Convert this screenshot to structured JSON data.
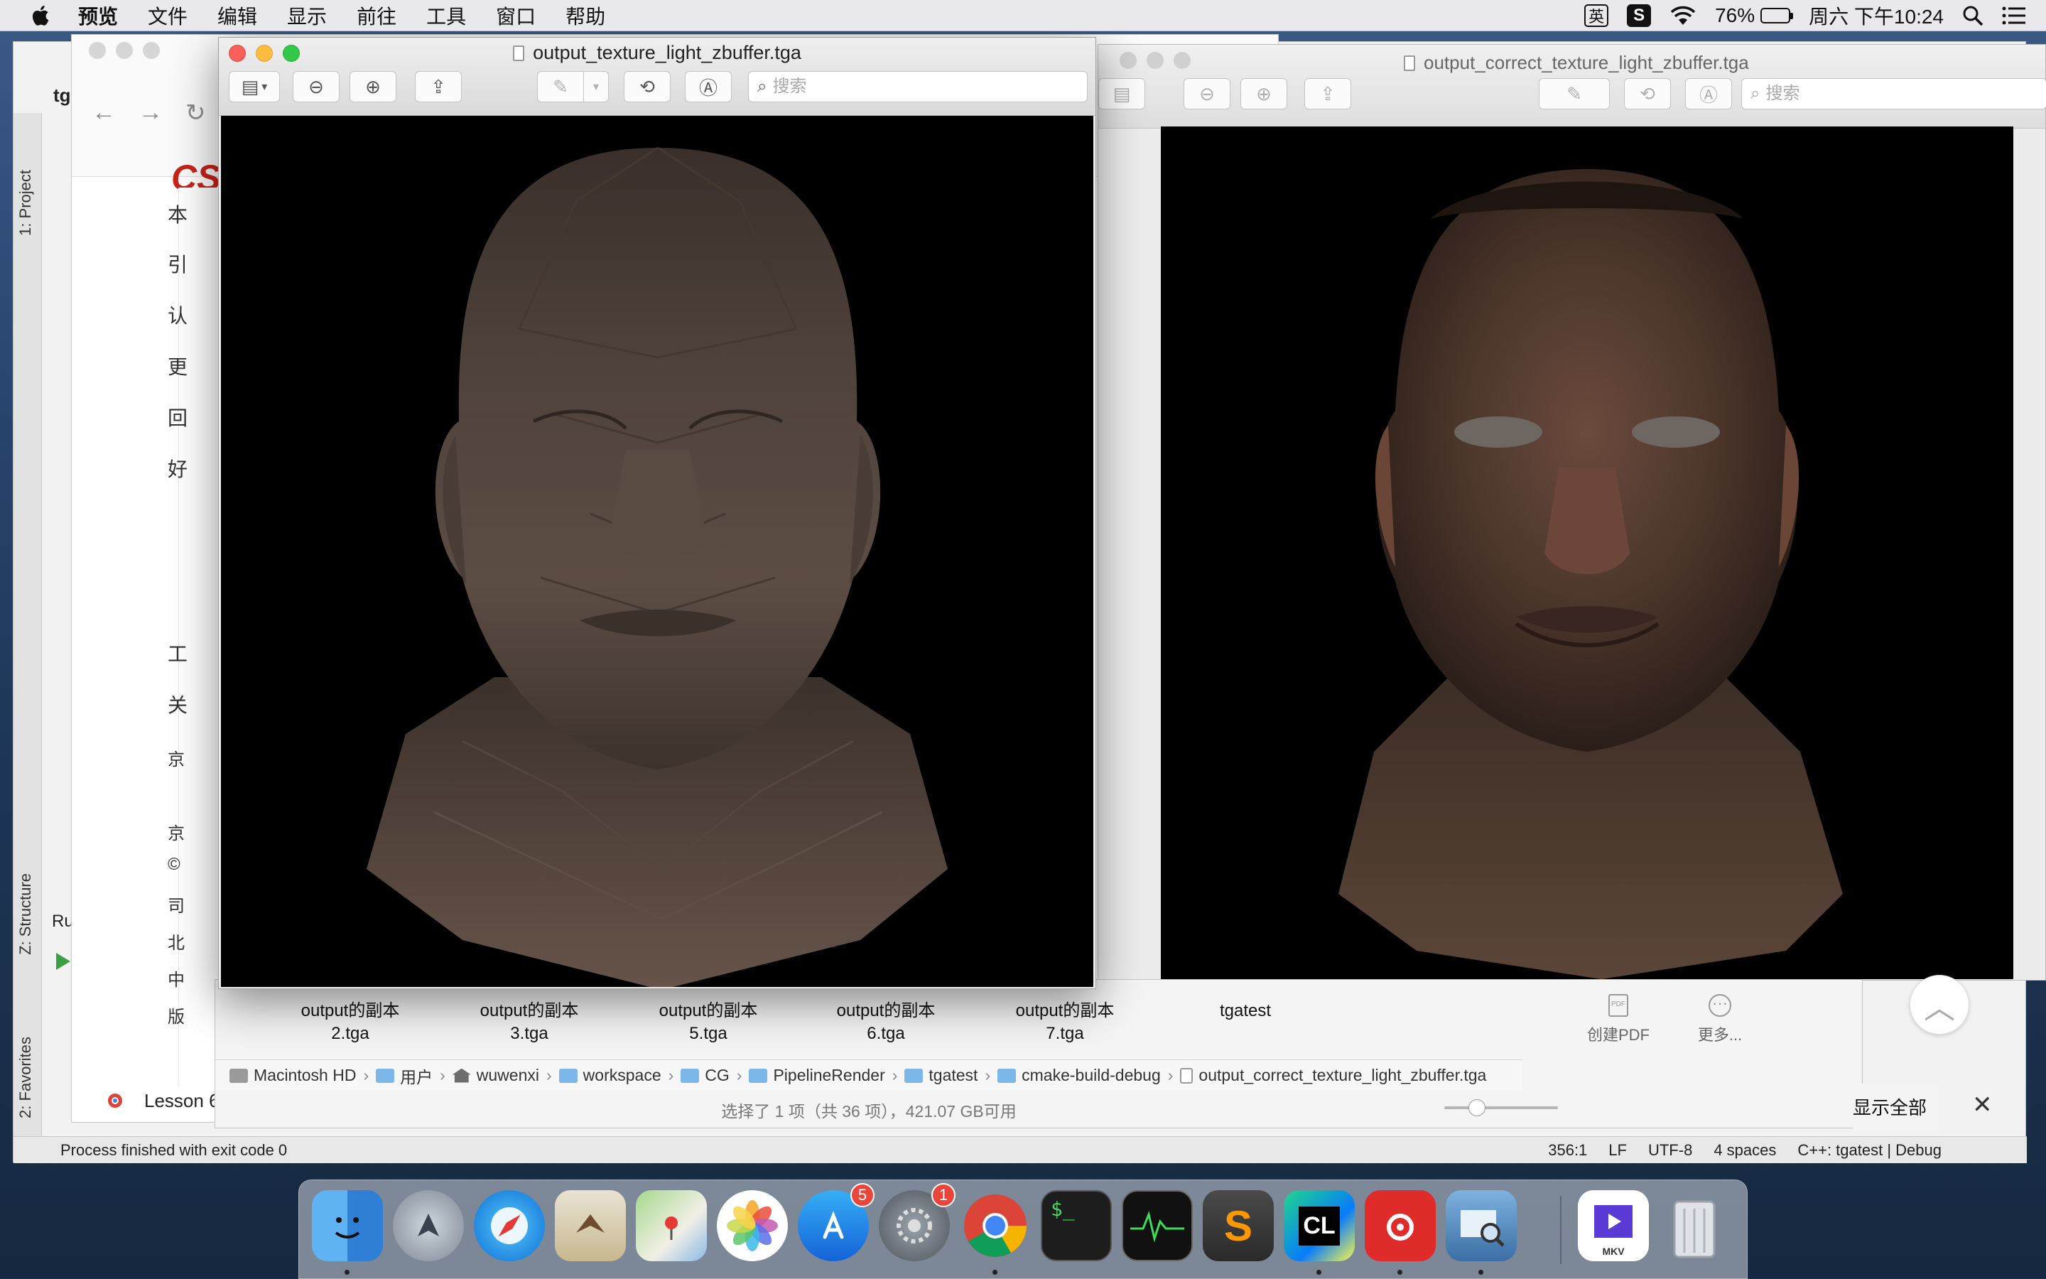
{
  "menubar": {
    "app_name": "预览",
    "items": [
      "文件",
      "编辑",
      "显示",
      "前往",
      "工具",
      "窗口",
      "帮助"
    ],
    "input_method": "英",
    "battery_percent": "76%",
    "battery_level": 0.76,
    "clock": "周六 下午10:24"
  },
  "ide": {
    "left_tabs": {
      "project": "1: Project",
      "structure": "Z: Structure",
      "favorites": "2: Favorites"
    },
    "run_tab": "Ru",
    "file_tab": "tga",
    "status_message": "Process finished with exit code 0",
    "status_right": [
      "356:1",
      "LF",
      "UTF-8",
      "4 spaces",
      "C++: tgatest | Debug"
    ]
  },
  "browser": {
    "logo": "CS",
    "sidebar_chars": [
      "本",
      "引",
      "认",
      "更",
      "回",
      "好",
      "工",
      "关",
      "京",
      "京",
      "©",
      "司",
      "北",
      "中",
      "版"
    ],
    "tab_label": "Lesson 6"
  },
  "preview_front": {
    "title": "output_texture_light_zbuffer.tga",
    "search_placeholder": "搜索",
    "image_alt": "Flat-shaded low-poly head with uniform grey-brown lighting"
  },
  "preview_back": {
    "title": "output_correct_texture_light_zbuffer.tga",
    "search_placeholder": "搜索",
    "image_alt": "Textured head with realistic skin detail"
  },
  "finder": {
    "thumbnails": [
      {
        "line1": "output的副本",
        "line2": "2.tga"
      },
      {
        "line1": "output的副本",
        "line2": "3.tga"
      },
      {
        "line1": "output的副本",
        "line2": "5.tga"
      },
      {
        "line1": "output的副本",
        "line2": "6.tga"
      },
      {
        "line1": "output的副本",
        "line2": "7.tga"
      },
      {
        "line1": "tgatest",
        "line2": ""
      }
    ],
    "path": [
      "Macintosh HD",
      "用户",
      "wuwenxi",
      "workspace",
      "CG",
      "PipelineRender",
      "tgatest",
      "cmake-build-debug",
      "output_correct_texture_light_zbuffer.tga"
    ],
    "status": "选择了 1 项（共 36 项），421.07 GB可用",
    "actions": {
      "create_pdf": "创建PDF",
      "more": "更多..."
    },
    "show_all": "显示全部"
  },
  "dock": {
    "apps": [
      {
        "name": "Finder",
        "running": true
      },
      {
        "name": "Launchpad",
        "running": false
      },
      {
        "name": "Safari",
        "running": false
      },
      {
        "name": "Mail",
        "running": false
      },
      {
        "name": "Maps",
        "running": false
      },
      {
        "name": "Photos",
        "running": false
      },
      {
        "name": "App Store",
        "running": false,
        "badge": "5"
      },
      {
        "name": "System Preferences",
        "running": false,
        "badge": "1"
      },
      {
        "name": "Chrome",
        "running": true
      },
      {
        "name": "Terminal",
        "running": false
      },
      {
        "name": "Activity Monitor",
        "running": false
      },
      {
        "name": "Sublime Text",
        "running": false
      },
      {
        "name": "CLion",
        "running": true
      },
      {
        "name": "NetEase Music",
        "running": true
      },
      {
        "name": "Preview",
        "running": true
      },
      {
        "name": "MKV Player",
        "running": false
      },
      {
        "name": "Trash",
        "running": false
      }
    ],
    "mkv_label": "MKV"
  },
  "colors": {
    "traffic_red": "#fc605b",
    "traffic_yellow": "#fdbc40",
    "traffic_green": "#34c84a",
    "badge_red": "#e9453b",
    "csdn_red": "#c8231b",
    "folder_blue": "#7cb7ea"
  }
}
